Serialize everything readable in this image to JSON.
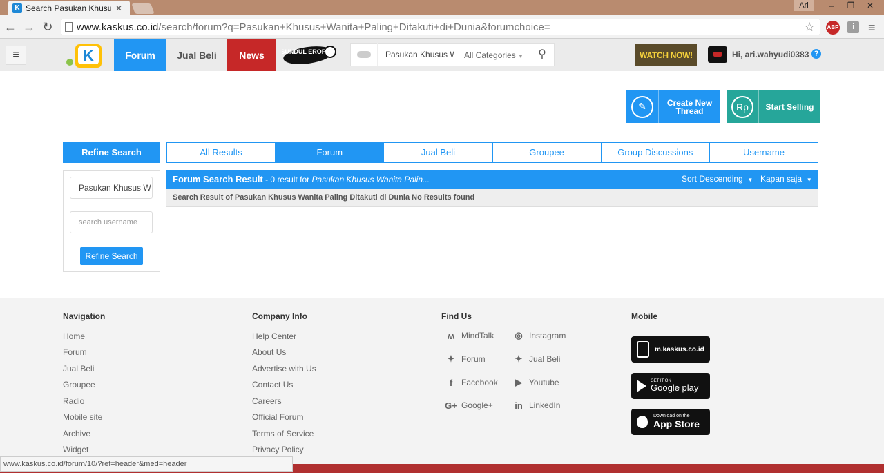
{
  "browser": {
    "tab_title": "Search Pasukan Khusus W",
    "tab_icon": "kaskus-favicon",
    "user": "Ari",
    "url_host": "www.kaskus.co.id",
    "url_path": "/search/forum?q=Pasukan+Khusus+Wanita+Paling+Ditakuti+di+Dunia&forumchoice=",
    "status_url": "www.kaskus.co.id/forum/10/?ref=header&med=header",
    "abp_label": "ABP"
  },
  "header": {
    "nav": [
      "Forum",
      "Jual Beli",
      "News"
    ],
    "search_query": "Pasukan Khusus W",
    "category": "All Categories",
    "banner": "WATCH NOW!",
    "greeting": "Hi, ari.wahyudi0383",
    "sundul_logo": "SUNDUL EROPA"
  },
  "actions": {
    "create_thread": "Create New Thread",
    "start_selling": "Start Selling",
    "rp_icon": "Rp"
  },
  "search": {
    "refine_title": "Refine Search",
    "tabs": [
      "All Results",
      "Forum",
      "Jual Beli",
      "Groupee",
      "Group Discussions",
      "Username"
    ],
    "active_tab": "Forum",
    "keyword_value": "Pasukan Khusus W",
    "username_placeholder": "search username",
    "refine_button": "Refine Search",
    "result_title": "Forum Search Result",
    "result_count": " - 0 result for ",
    "result_query": "Pasukan Khusus Wanita Palin...",
    "sort": "Sort Descending",
    "time": "Kapan saja",
    "no_result": "Search Result of Pasukan Khusus Wanita Paling Ditakuti di Dunia No Results found"
  },
  "footer": {
    "navigation": {
      "title": "Navigation",
      "links": [
        "Home",
        "Forum",
        "Jual Beli",
        "Groupee",
        "Radio",
        "Mobile site",
        "Archive",
        "Widget"
      ]
    },
    "company": {
      "title": "Company Info",
      "links": [
        "Help Center",
        "About Us",
        "Advertise with Us",
        "Contact Us",
        "Careers",
        "Official Forum",
        "Terms of Service",
        "Privacy Policy"
      ]
    },
    "find_us": {
      "title": "Find Us",
      "left": [
        "MindTalk",
        "Forum",
        "Facebook",
        "Google+"
      ],
      "right": [
        "Instagram",
        "Jual Beli",
        "Youtube",
        "LinkedIn"
      ]
    },
    "mobile": {
      "title": "Mobile",
      "site": "m.kaskus.co.id",
      "google_small": "GET IT ON",
      "google_big": "Google play",
      "apple_small": "Download on the",
      "apple_big": "App Store"
    }
  },
  "colors": {
    "primary": "#2196f3",
    "news": "#c62828",
    "selling": "#26a69a"
  }
}
